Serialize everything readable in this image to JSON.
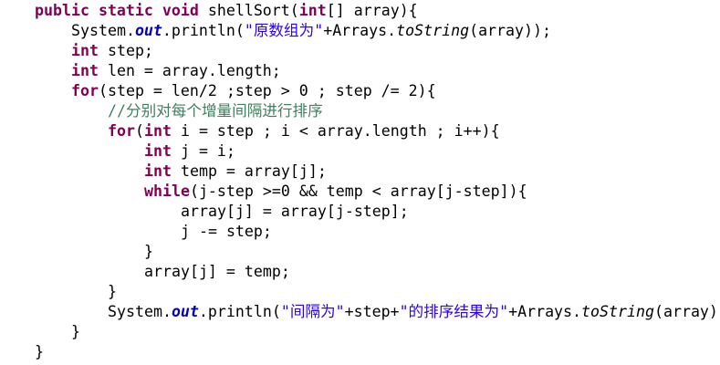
{
  "editor": {
    "lines": [
      {
        "indent": 1,
        "tokens": [
          {
            "t": "public",
            "k": "kw"
          },
          {
            "t": " ",
            "k": "plain"
          },
          {
            "t": "static",
            "k": "kw"
          },
          {
            "t": " ",
            "k": "plain"
          },
          {
            "t": "void",
            "k": "kw"
          },
          {
            "t": " shellSort(",
            "k": "plain"
          },
          {
            "t": "int",
            "k": "kw"
          },
          {
            "t": "[] array){",
            "k": "plain"
          }
        ]
      },
      {
        "indent": 2,
        "tokens": [
          {
            "t": "System.",
            "k": "plain"
          },
          {
            "t": "out",
            "k": "field"
          },
          {
            "t": ".println(",
            "k": "plain"
          },
          {
            "t": "\"原数组为\"",
            "k": "string"
          },
          {
            "t": "+Arrays.",
            "k": "plain"
          },
          {
            "t": "toString",
            "k": "static-method"
          },
          {
            "t": "(array));",
            "k": "plain"
          }
        ]
      },
      {
        "indent": 2,
        "tokens": [
          {
            "t": "int",
            "k": "kw"
          },
          {
            "t": " step;",
            "k": "plain"
          }
        ]
      },
      {
        "indent": 2,
        "tokens": [
          {
            "t": "int",
            "k": "kw"
          },
          {
            "t": " len = array.length;",
            "k": "plain"
          }
        ]
      },
      {
        "indent": 2,
        "tokens": [
          {
            "t": "for",
            "k": "kw"
          },
          {
            "t": "(step = len/2 ;step > 0 ; step /= 2){",
            "k": "plain"
          }
        ]
      },
      {
        "indent": 3,
        "tokens": [
          {
            "t": "//分别对每个增量间隔进行排序",
            "k": "comment"
          }
        ]
      },
      {
        "indent": 3,
        "tokens": [
          {
            "t": "for",
            "k": "kw"
          },
          {
            "t": "(",
            "k": "plain"
          },
          {
            "t": "int",
            "k": "kw"
          },
          {
            "t": " i = step ; i < array.length ; i++){",
            "k": "plain"
          }
        ]
      },
      {
        "indent": 4,
        "tokens": [
          {
            "t": "int",
            "k": "kw"
          },
          {
            "t": " j = i;",
            "k": "plain"
          }
        ]
      },
      {
        "indent": 4,
        "tokens": [
          {
            "t": "int",
            "k": "kw"
          },
          {
            "t": " temp = array[j];",
            "k": "plain"
          }
        ]
      },
      {
        "indent": 4,
        "tokens": [
          {
            "t": "while",
            "k": "kw"
          },
          {
            "t": "(j-step >=0 && temp < array[j-step]){",
            "k": "plain"
          }
        ]
      },
      {
        "indent": 5,
        "tokens": [
          {
            "t": "array[j] = array[j-step];",
            "k": "plain"
          }
        ]
      },
      {
        "indent": 5,
        "tokens": [
          {
            "t": "j -= step;",
            "k": "plain"
          }
        ]
      },
      {
        "indent": 4,
        "tokens": [
          {
            "t": "}",
            "k": "plain"
          }
        ]
      },
      {
        "indent": 4,
        "tokens": [
          {
            "t": "array[j] = temp;",
            "k": "plain"
          }
        ]
      },
      {
        "indent": 3,
        "tokens": [
          {
            "t": "}",
            "k": "plain"
          }
        ]
      },
      {
        "indent": 3,
        "tokens": [
          {
            "t": "System.",
            "k": "plain"
          },
          {
            "t": "out",
            "k": "field"
          },
          {
            "t": ".println(",
            "k": "plain"
          },
          {
            "t": "\"间隔为\"",
            "k": "string"
          },
          {
            "t": "+step+",
            "k": "plain"
          },
          {
            "t": "\"的排序结果为\"",
            "k": "string"
          },
          {
            "t": "+Arrays.",
            "k": "plain"
          },
          {
            "t": "toString",
            "k": "static-method"
          },
          {
            "t": "(array));",
            "k": "plain"
          }
        ]
      },
      {
        "indent": 2,
        "tokens": [
          {
            "t": "}",
            "k": "plain"
          }
        ]
      },
      {
        "indent": 1,
        "tokens": [
          {
            "t": "}",
            "k": "plain"
          }
        ]
      }
    ]
  },
  "colors": {
    "background": "#ffffff",
    "keyword": "#7f0055",
    "plain": "#000000",
    "static_field": "#0000c0",
    "string": "#2a00ff",
    "comment": "#3f7f5f"
  }
}
